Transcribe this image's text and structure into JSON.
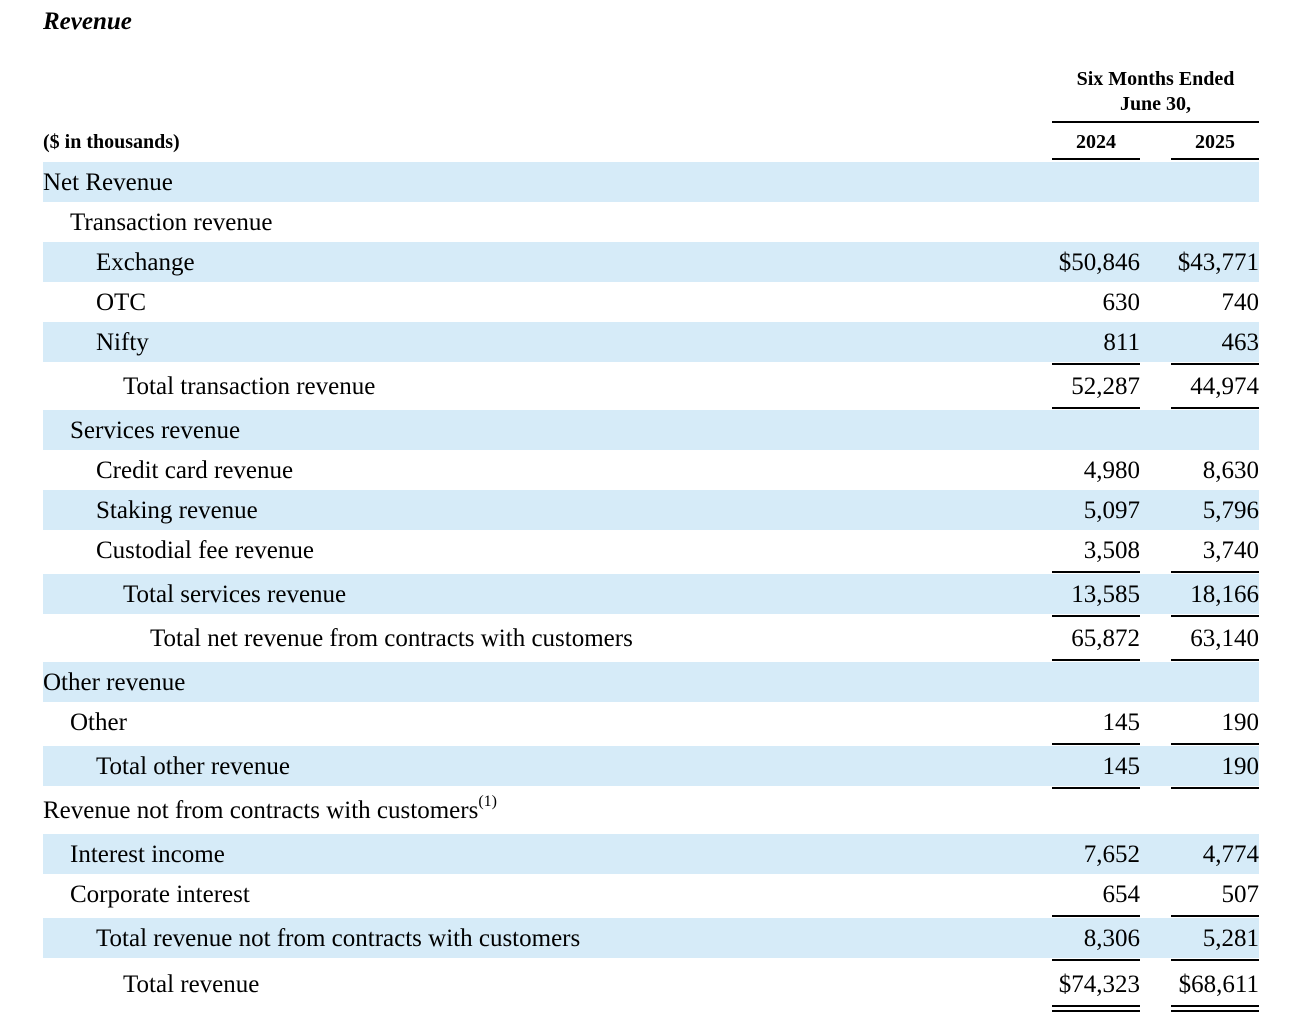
{
  "title": "Revenue",
  "header": {
    "period_line1": "Six Months Ended",
    "period_line2": "June 30,",
    "units": "($ in thousands)",
    "year1": "2024",
    "year2": "2025"
  },
  "rows": [
    {
      "name": "net-revenue-heading",
      "label": "Net Revenue",
      "v1": "",
      "v2": "",
      "indent": 0,
      "shade": true
    },
    {
      "name": "transaction-revenue-heading",
      "label": "Transaction revenue",
      "v1": "",
      "v2": "",
      "indent": 1,
      "shade": false
    },
    {
      "name": "exchange-row",
      "label": "Exchange",
      "v1": "$50,846",
      "v2": "$43,771",
      "indent": 2,
      "shade": true
    },
    {
      "name": "otc-row",
      "label": "OTC",
      "v1": "630",
      "v2": "740",
      "indent": 2,
      "shade": false
    },
    {
      "name": "nifty-row",
      "label": "Nifty",
      "v1": "811",
      "v2": "463",
      "indent": 2,
      "shade": true,
      "rule_below": "single"
    },
    {
      "name": "total-transaction-revenue-row",
      "label": "Total transaction revenue",
      "v1": "52,287",
      "v2": "44,974",
      "indent": 3,
      "shade": false,
      "rule_below": "single"
    },
    {
      "name": "services-revenue-heading",
      "label": "Services revenue",
      "v1": "",
      "v2": "",
      "indent": 1,
      "shade": true
    },
    {
      "name": "credit-card-revenue-row",
      "label": "Credit card revenue",
      "v1": "4,980",
      "v2": "8,630",
      "indent": 2,
      "shade": false
    },
    {
      "name": "staking-revenue-row",
      "label": "Staking revenue",
      "v1": "5,097",
      "v2": "5,796",
      "indent": 2,
      "shade": true
    },
    {
      "name": "custodial-fee-revenue-row",
      "label": "Custodial fee revenue",
      "v1": "3,508",
      "v2": "3,740",
      "indent": 2,
      "shade": false,
      "rule_below": "single"
    },
    {
      "name": "total-services-revenue-row",
      "label": "Total services revenue",
      "v1": "13,585",
      "v2": "18,166",
      "indent": 3,
      "shade": true,
      "rule_below": "single"
    },
    {
      "name": "total-net-revenue-contracts-row",
      "label": "Total net revenue from contracts with customers",
      "v1": "65,872",
      "v2": "63,140",
      "indent": 4,
      "shade": false,
      "rule_below": "single"
    },
    {
      "name": "other-revenue-heading",
      "label": "Other revenue",
      "v1": "",
      "v2": "",
      "indent": 0,
      "shade": true
    },
    {
      "name": "other-row",
      "label": "Other",
      "v1": "145",
      "v2": "190",
      "indent": 1,
      "shade": false,
      "rule_below": "single"
    },
    {
      "name": "total-other-revenue-row",
      "label": "Total other revenue",
      "v1": "145",
      "v2": "190",
      "indent": 2,
      "shade": true,
      "rule_below": "single"
    },
    {
      "name": "revenue-not-from-contracts-heading",
      "label": "Revenue not from contracts with customers",
      "sup": "(1)",
      "v1": "",
      "v2": "",
      "indent": 0,
      "shade": false
    },
    {
      "name": "interest-income-row",
      "label": "Interest income",
      "v1": "7,652",
      "v2": "4,774",
      "indent": 1,
      "shade": true
    },
    {
      "name": "corporate-interest-row",
      "label": "Corporate interest",
      "v1": "654",
      "v2": "507",
      "indent": 1,
      "shade": false,
      "rule_below": "single"
    },
    {
      "name": "total-revenue-not-from-contracts-row",
      "label": "Total revenue not from contracts with customers",
      "v1": "8,306",
      "v2": "5,281",
      "indent": 2,
      "shade": true,
      "rule_below": "single"
    },
    {
      "name": "total-revenue-row",
      "label": "Total revenue",
      "v1": "$74,323",
      "v2": "$68,611",
      "indent": 3,
      "shade": false,
      "rule_below": "double"
    }
  ]
}
